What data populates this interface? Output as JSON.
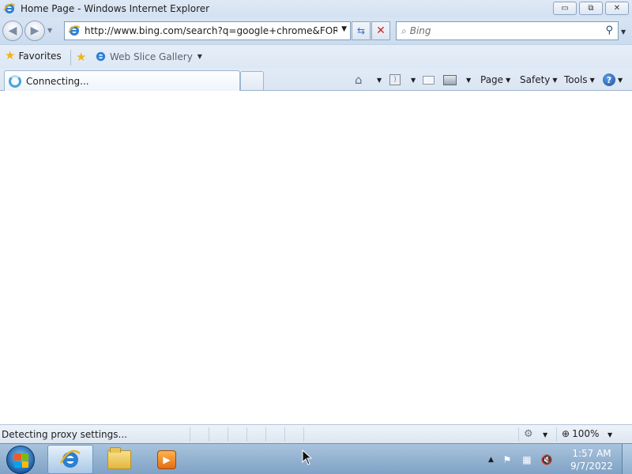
{
  "window": {
    "title": "Home Page - Windows Internet Explorer",
    "minimize_label": "▭",
    "restore_label": "⧉",
    "close_label": "✕"
  },
  "nav": {
    "address_url": "http://www.bing.com/search?q=google+chrome&FORM=IE",
    "search_placeholder": "Bing"
  },
  "favorites_bar": {
    "favorites_label": "Favorites",
    "web_slice_gallery_label": "Web Slice Gallery"
  },
  "tabs": [
    {
      "label": "Connecting..."
    }
  ],
  "command_bar": {
    "page_label": "Page",
    "safety_label": "Safety",
    "tools_label": "Tools"
  },
  "status_bar": {
    "status_text": "Detecting proxy settings...",
    "zoom_label": "100%"
  },
  "taskbar": {
    "time": "1:57 AM",
    "date": "9/7/2022"
  },
  "colors": {
    "chrome_blue": "#d3e1f1",
    "taskbar_blue": "#7fa2c6",
    "close_red": "#c6282b"
  },
  "icons": [
    "ie-icon",
    "back-icon",
    "forward-icon",
    "refresh-icon",
    "stop-icon",
    "search-icon",
    "favorites-star-icon",
    "add-favorites-icon",
    "home-icon",
    "feeds-icon",
    "mail-icon",
    "print-icon",
    "help-icon",
    "loading-spinner-icon",
    "zone-icon",
    "zoom-icon",
    "start-orb-icon",
    "folder-icon",
    "media-player-icon",
    "flag-icon",
    "network-icon",
    "volume-muted-icon"
  ]
}
